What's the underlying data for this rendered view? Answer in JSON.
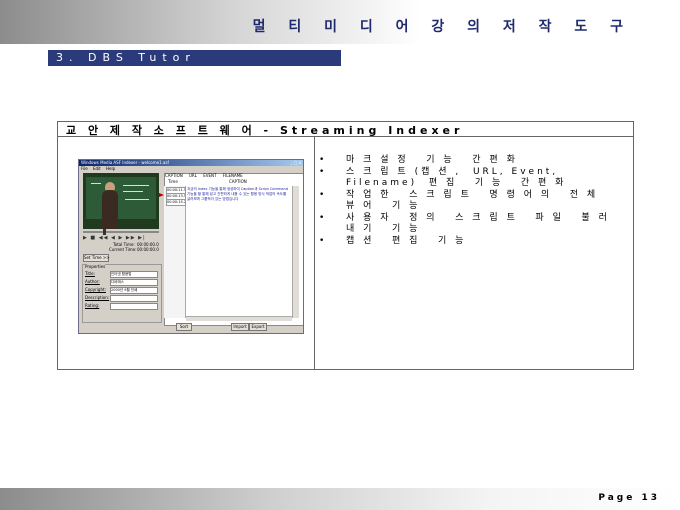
{
  "slide": {
    "title": "멀 티 미 디 어   강 의   저 작   도 구",
    "section": "3. DBS Tutor",
    "page_label": "Page 13"
  },
  "table": {
    "header": "교 안 제 작   소 프 트 웨 어   -  Streaming Indexer",
    "bullets": [
      "마 크 설 정   기 능   간 편 화",
      "스 크 립 트 (캡 션 ,  URL, Event,\nFilename)  편 집   기 능   간 편 화",
      "작 업 한   스 크 립 트   명 령 어 의   전 체\n뷰 어   기 능",
      "사 용 자   정 의   스 크 립 트   파 일   불 러\n내 기   기 능",
      "캡 션   편 집   기 능"
    ]
  },
  "app": {
    "window_title": "Windows Media ASF Indexer - welcome1.asf",
    "window_controls": "_ □ x",
    "menu": [
      "File",
      "Edit",
      "Help"
    ],
    "transport": "▶ ■ ◀◀ ◀ ▶ ▶▶ ▶|",
    "total_time_label": "Total Time:",
    "total_time": "00:00:00.0",
    "current_time_label": "Current Time:",
    "current_time": "00:00:00.0",
    "set_time_button": "Set Time >>",
    "properties_legend": "Properties",
    "fields": [
      {
        "label": "Title:",
        "value": "인터넷 활용법"
      },
      {
        "label": "Author:",
        "value": "디비에스"
      },
      {
        "label": "Copyright:",
        "value": "2000년 9월 인쇄"
      },
      {
        "label": "Description:",
        "value": ""
      },
      {
        "label": "Rating:",
        "value": ""
      }
    ],
    "tabs": [
      "CAPTION",
      "URL",
      "EVENT",
      "FILENAME"
    ],
    "col_time": "Time",
    "col_caption": "CAPTION",
    "times": [
      "00:00:11.5",
      "00:00:13.5",
      "00:00:15.2"
    ],
    "caption_text": "지금의 Index 기능을 통해 생성하여 Caption과 Script Command 기능을 할 통해 쉽고 간편하게 내용 수 있는 활용 방식 적업의 속도를 살려보며 그룹적이 있는 방법입니다",
    "sort_button": "Sort",
    "import_button": "Import",
    "export_button": "Export"
  }
}
